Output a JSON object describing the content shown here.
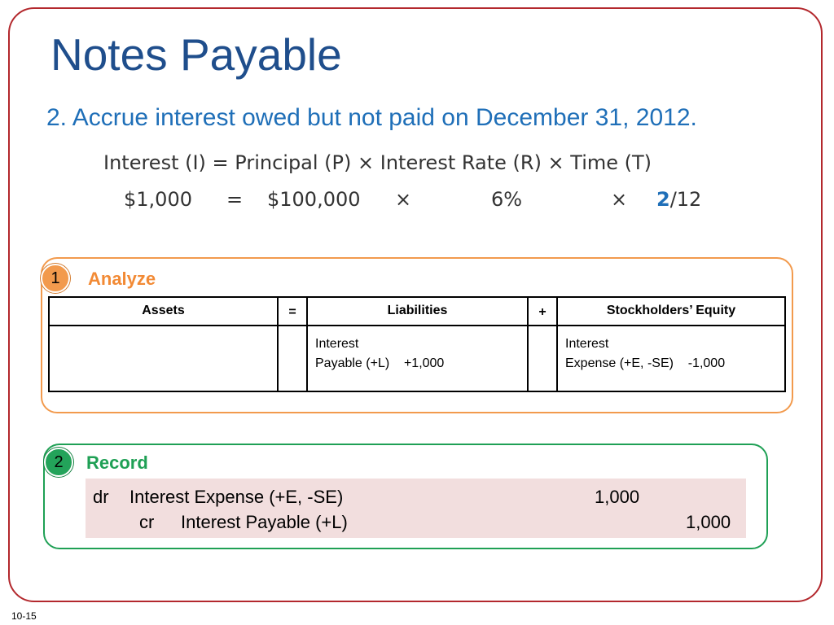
{
  "slide": {
    "title": "Notes Payable",
    "subtitle": "2. Accrue interest owed but not paid on December 31, 2012.",
    "page_number": "10-15"
  },
  "formula": {
    "line1": "Interest (I) = Principal (P) × Interest Rate (R) × Time (T)",
    "line2": {
      "interest": "$1,000",
      "equals": "=",
      "principal": "$100,000",
      "times1": "×",
      "rate": "6%",
      "times2": "×",
      "time_highlight": "2",
      "time_rest": "/12"
    }
  },
  "analyze": {
    "step_number": "1",
    "label": "Analyze",
    "headers": {
      "assets": "Assets",
      "equals": "=",
      "liabilities": "Liabilities",
      "plus": "+",
      "equity": "Stockholders’ Equity"
    },
    "liabilities_cell": {
      "line1": "Interest",
      "line2": "Payable (+L)    +1,000"
    },
    "equity_cell": {
      "line1": "Interest",
      "line2": "Expense (+E, -SE)    -1,000"
    }
  },
  "record": {
    "step_number": "2",
    "label": "Record",
    "debit": {
      "prefix": "dr",
      "account": "Interest Expense (+E, -SE)",
      "amount": "1,000"
    },
    "credit": {
      "prefix": "cr",
      "account": "Interest Payable (+L)",
      "amount": "1,000"
    }
  },
  "colors": {
    "border": "#b3282d",
    "title": "#1f4e8c",
    "subtitle": "#1f6fb8",
    "analyze": "#f29a4d",
    "record": "#1fa055",
    "record_bg": "#f2dede"
  }
}
